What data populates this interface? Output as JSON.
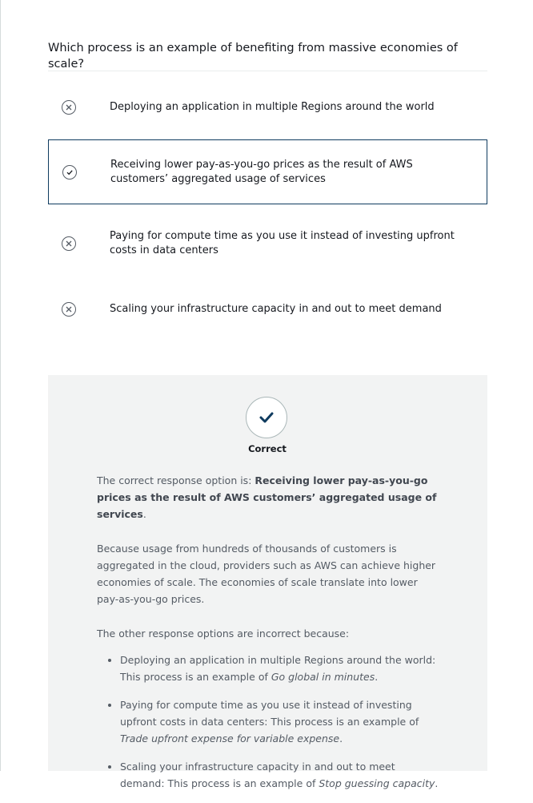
{
  "question": {
    "text": "Which process is an example of benefiting from massive economies of scale?"
  },
  "options": [
    {
      "label": "Deploying an application in multiple Regions around the world",
      "icon": "x-circle-icon",
      "selected": false
    },
    {
      "label": "Receiving lower pay-as-you-go prices as the result of AWS customers’ aggregated usage of services",
      "icon": "check-circle-icon",
      "selected": true
    },
    {
      "label": "Paying for compute time as you use it instead of investing upfront costs in data centers",
      "icon": "x-circle-icon",
      "selected": false
    },
    {
      "label": "Scaling your infrastructure capacity in and out to meet demand",
      "icon": "x-circle-icon",
      "selected": false
    }
  ],
  "feedback": {
    "status": "Correct",
    "status_icon": "checkmark-icon",
    "accent_color": "#0f3b5f",
    "correct_prefix": "The correct response option is: ",
    "correct_answer": "Receiving lower pay-as-you-go prices as the result of AWS customers’ aggregated usage of services",
    "correct_suffix": ".",
    "explanation": "Because usage from hundreds of thousands of customers is aggregated in the cloud, providers such as AWS can achieve higher economies of scale. The economies of scale translate into lower pay-as-you-go prices.",
    "others_intro": "The other response options are incorrect because:",
    "others": [
      {
        "text": "Deploying an application in multiple Regions around the world: This process is an example of ",
        "emphasis": "Go global in minutes",
        "end": "."
      },
      {
        "text": "Paying for compute time as you use it instead of investing upfront costs in data centers: This process is an example of ",
        "emphasis": "Trade upfront expense for variable expense",
        "end": "."
      },
      {
        "text": "Scaling your infrastructure capacity in and out to meet demand: This process is an example of ",
        "emphasis": "Stop guessing capacity",
        "end": "."
      }
    ]
  }
}
